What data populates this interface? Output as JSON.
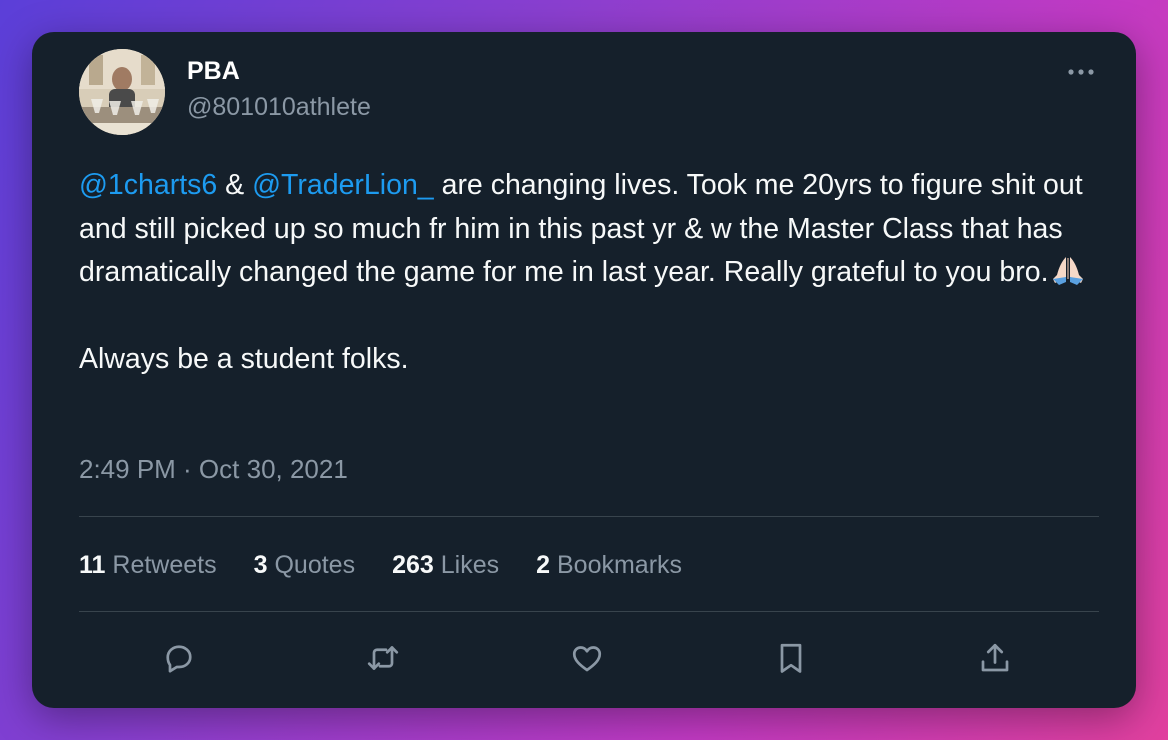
{
  "author": {
    "name": "PBA",
    "handle": "@801010athlete"
  },
  "tweet": {
    "mention1": "@1charts6",
    "amp": " & ",
    "mention2": "@TraderLion_",
    "body_part1": " are changing lives. Took me 20yrs to figure shit out and still picked up so much fr him in this past yr & w the Master Class that has dramatically changed the game for me in last year. Really grateful to you bro.",
    "emoji": "folded-hands-emoji",
    "body_part2": "\n\nAlways be a student folks."
  },
  "timestamp": "2:49 PM · Oct 30, 2021",
  "stats": [
    {
      "count": "11",
      "label": "Retweets"
    },
    {
      "count": "3",
      "label": "Quotes"
    },
    {
      "count": "263",
      "label": "Likes"
    },
    {
      "count": "2",
      "label": "Bookmarks"
    }
  ],
  "actions": [
    "reply-icon",
    "retweet-icon",
    "like-icon",
    "bookmark-icon",
    "share-icon"
  ],
  "colors": {
    "card_bg": "#15202b",
    "mention": "#1d9bf0",
    "muted": "#8b98a5",
    "text": "#f7f9f9",
    "divider": "#38444d"
  }
}
